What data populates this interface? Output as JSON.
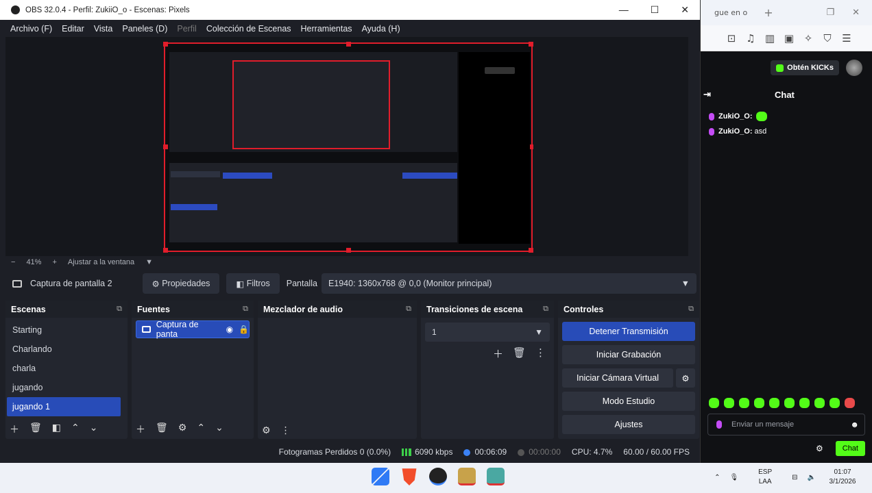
{
  "obs": {
    "title": "OBS 32.0.4 - Perfil: ZukiiO_o - Escenas: Pixels",
    "window_controls": {
      "minimize": "—",
      "maximize": "☐",
      "close": "✕"
    },
    "menu": [
      "Archivo (F)",
      "Editar",
      "Vista",
      "Paneles (D)",
      "Perfil",
      "Colección de Escenas",
      "Herramientas",
      "Ayuda (H)"
    ],
    "zoom": {
      "minus": "−",
      "value": "41%",
      "plus": "+",
      "fit": "Ajustar a la ventana",
      "dropdown": "▼"
    },
    "source_bar": {
      "source_name": "Captura de pantalla 2",
      "properties": "Propiedades",
      "filters": "Filtros",
      "display_label": "Pantalla",
      "display_value": "E1940: 1360x768 @ 0,0 (Monitor principal)"
    },
    "docks": {
      "scenes": {
        "title": "Escenas",
        "items": [
          "Starting",
          "Charlando",
          "charla",
          "jugando",
          "jugando 1"
        ],
        "selected": "jugando 1"
      },
      "sources": {
        "title": "Fuentes",
        "item": "Captura de panta"
      },
      "mixer": {
        "title": "Mezclador de audio"
      },
      "transitions": {
        "title": "Transiciones de escena",
        "value": "1"
      },
      "controls": {
        "title": "Controles",
        "stop_stream": "Detener Transmisión",
        "start_record": "Iniciar Grabación",
        "start_vcam": "Iniciar Cámara Virtual",
        "studio_mode": "Modo Estudio",
        "settings": "Ajustes"
      }
    },
    "status": {
      "dropped": "Fotogramas Perdidos 0 (0.0%)",
      "bitrate": "6090 kbps",
      "stream_time": "00:06:09",
      "record_time": "00:00:00",
      "cpu": "CPU: 4.7%",
      "fps": "60.00 / 60.00 FPS"
    }
  },
  "browser": {
    "tab_text": "gue en o",
    "kick_button": "Obtén KICKs",
    "chat_title": "Chat",
    "messages": [
      {
        "user": "ZukiO_O:",
        "text": ""
      },
      {
        "user": "ZukiO_O:",
        "text": "asd"
      }
    ],
    "input_placeholder": "Enviar un mensaje",
    "chat_button": "Chat"
  },
  "taskbar": {
    "lang": "ESP",
    "layout": "LAA",
    "time": "01:07",
    "date": "3/1/2026"
  },
  "colors": {
    "accent": "#284cb8",
    "selection_red": "#e11d2b",
    "kick_green": "#53fc18"
  }
}
